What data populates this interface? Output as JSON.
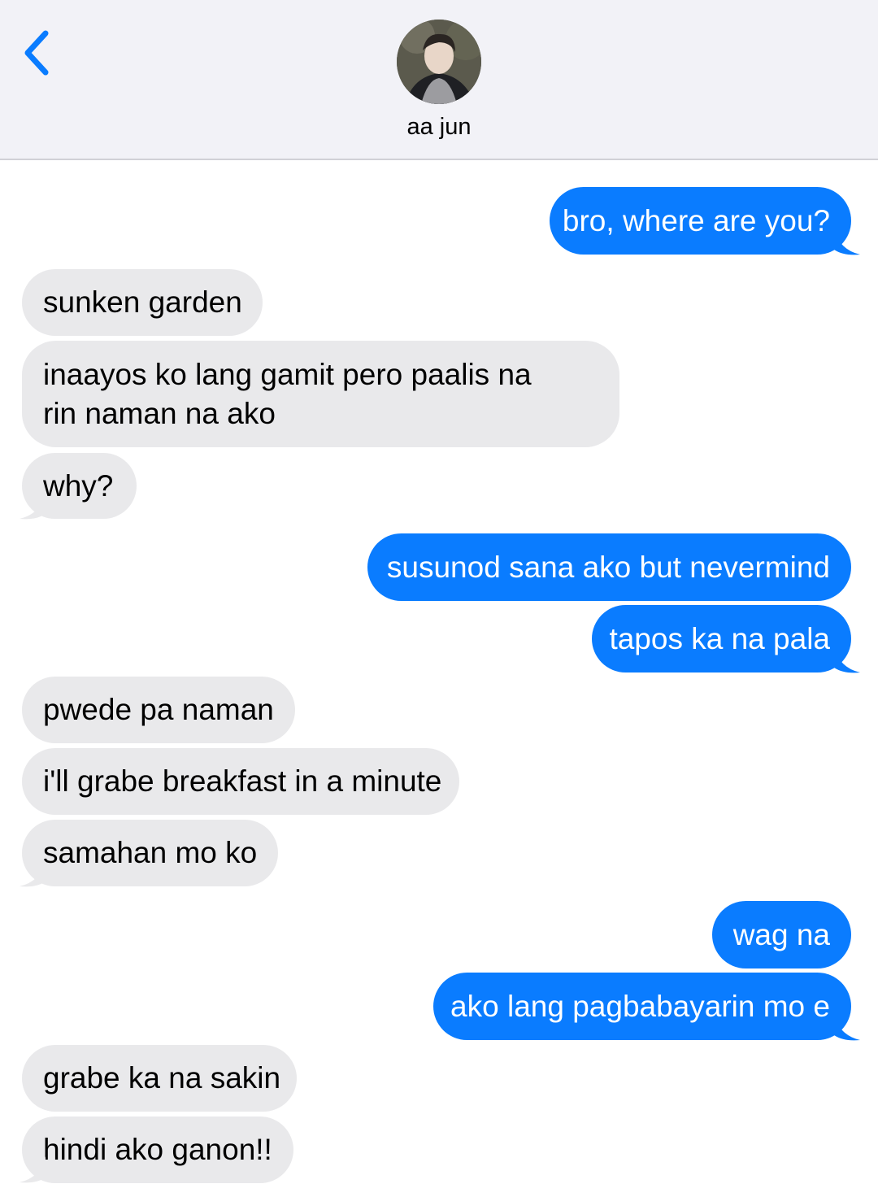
{
  "header": {
    "back_icon": "chevron-left-icon",
    "contact_name": "aa jun",
    "accent": "#0a7cff"
  },
  "messages": [
    {
      "from": "me",
      "text": "bro, where are you?"
    },
    {
      "from": "them",
      "text": "sunken garden"
    },
    {
      "from": "them",
      "text": "inaayos ko lang gamit pero paalis na rin naman na ako"
    },
    {
      "from": "them",
      "text": "why?"
    },
    {
      "from": "me",
      "text": "susunod sana ako but nevermind"
    },
    {
      "from": "me",
      "text": "tapos ka na pala"
    },
    {
      "from": "them",
      "text": "pwede pa naman"
    },
    {
      "from": "them",
      "text": "i'll grabe breakfast in a minute"
    },
    {
      "from": "them",
      "text": "samahan mo ko"
    },
    {
      "from": "me",
      "text": "wag na"
    },
    {
      "from": "me",
      "text": "ako lang pagbabayarin mo e"
    },
    {
      "from": "them",
      "text": "grabe ka na sakin"
    },
    {
      "from": "them",
      "text": "hindi ako ganon!!"
    }
  ],
  "colors": {
    "outgoing_bubble": "#0a7cff",
    "incoming_bubble": "#e9e9eb",
    "header_bg": "#f2f2f7"
  }
}
